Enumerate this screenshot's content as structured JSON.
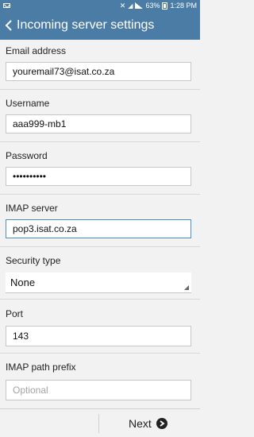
{
  "status_bar": {
    "time": "1:28 PM",
    "battery": "63%"
  },
  "header": {
    "title": "Incoming server settings"
  },
  "form": {
    "email": {
      "label": "Email address",
      "value": "youremail73@isat.co.za"
    },
    "username": {
      "label": "Username",
      "value": "aaa999-mb1"
    },
    "password": {
      "label": "Password",
      "value": "••••••••••"
    },
    "imap_server": {
      "label": "IMAP server",
      "value": "pop3.isat.co.za"
    },
    "security_type": {
      "label": "Security type",
      "value": "None"
    },
    "port": {
      "label": "Port",
      "value": "143"
    },
    "imap_path_prefix": {
      "label": "IMAP path prefix",
      "placeholder": "Optional"
    }
  },
  "footer": {
    "next_label": "Next"
  },
  "colors": {
    "header_bg": "#4a7ca6",
    "focus_border": "#4a90c8"
  }
}
